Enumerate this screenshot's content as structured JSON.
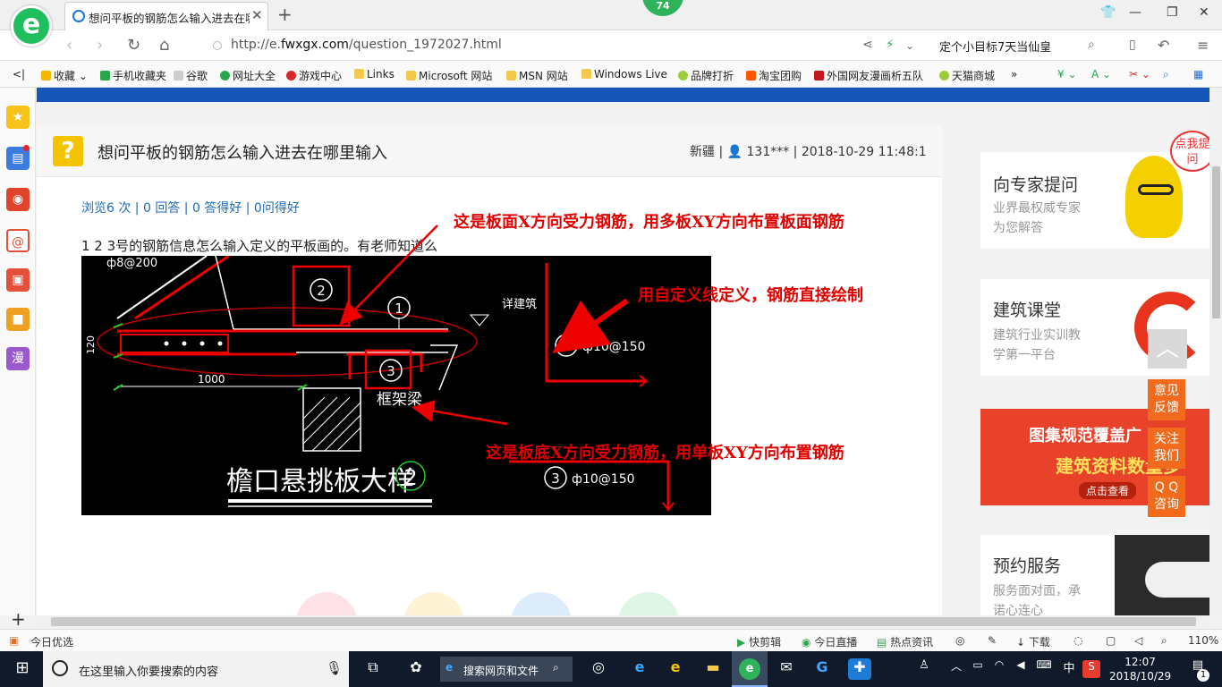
{
  "browser": {
    "logo": "e",
    "tab_title": "想问平板的钢筋怎么输入进去在哪里输入",
    "new_tab": "+",
    "badge": "74",
    "url_prefix": "http://e.",
    "url_domain": "fwxgx.com",
    "url_path": "/question_1972027.html",
    "search_text": "定个小目标7天当仙皇"
  },
  "bookmarks": [
    {
      "label": "收藏",
      "color": "#f5b800"
    },
    {
      "label": "手机收藏夹",
      "color": "#2aa74a"
    },
    {
      "label": "谷歌",
      "color": "#999999"
    },
    {
      "label": "网址大全",
      "color": "#2aa74a"
    },
    {
      "label": "游戏中心",
      "color": "#d42a2a"
    },
    {
      "label": "Links",
      "color": "#f2c94c"
    },
    {
      "label": "Microsoft 网站",
      "color": "#f2c94c"
    },
    {
      "label": "MSN 网站",
      "color": "#f2c94c"
    },
    {
      "label": "Windows Live",
      "color": "#f2c94c"
    },
    {
      "label": "品牌打折",
      "color": "#9bcc3a"
    },
    {
      "label": "淘宝团购",
      "color": "#ff5500"
    },
    {
      "label": "外国网友漫画析五队",
      "color": "#c4161c"
    },
    {
      "label": "天猫商城",
      "color": "#9bcc3a"
    }
  ],
  "sidebar_icons": [
    {
      "name": "favorites",
      "glyph": "★",
      "color": "#f7c21a"
    },
    {
      "name": "news",
      "glyph": "▤",
      "color": "#3c7be0"
    },
    {
      "name": "weibo",
      "glyph": "◉",
      "color": "#e0452c"
    },
    {
      "name": "mail",
      "glyph": "@",
      "color": "#e55039"
    },
    {
      "name": "games",
      "glyph": "▣",
      "color": "#e55039"
    },
    {
      "name": "reader",
      "glyph": "■",
      "color": "#f0a020"
    },
    {
      "name": "comic",
      "glyph": "漫",
      "color": "#9b59d0"
    }
  ],
  "question": {
    "mark": "?",
    "title": "想问平板的钢筋怎么输入进去在哪里输入",
    "meta": "新疆 | 👤 131*** | 2018-10-29 11:48:1",
    "stats": "浏览6 次 | 0 回答 | 0 答得好 | 0问得好",
    "body": "1 2 3号的钢筋信息怎么输入定义的平板画的。有老师知道么"
  },
  "annotations": {
    "top": "这是板面X方向受力钢筋，用多板XY方向布置板面钢筋",
    "right": "用自定义线定义，钢筋直接绘制",
    "bottom": "这是板底X方向受力钢筋，用单板XY方向布置钢筋"
  },
  "drawing": {
    "rebar_top": "ф8@200",
    "dim_120": "120",
    "dim_1000": "1000",
    "label_1": "1",
    "label_2": "2",
    "label_3": "3",
    "see_arch": "详建筑",
    "beam": "框架梁",
    "title": "檐口悬挑板大样",
    "title_num": "2",
    "spec_1": "ф10@150",
    "spec_3": "ф10@150"
  },
  "right_column": {
    "expert_title": "向专家提问",
    "expert_sub1": "业界最权威专家",
    "expert_sub2": "为您解答",
    "bubble": "点我提问",
    "course_title": "建筑课堂",
    "course_sub1": "建筑行业实训教",
    "course_sub2": "学第一平台",
    "banner_line1": "图集规范覆盖广",
    "banner_line2": "建筑资料数量多",
    "banner_btn": "点击查看",
    "service_title": "预约服务",
    "service_sub1": "服务面对面，承",
    "service_sub2": "诺心连心"
  },
  "float_buttons": [
    "意见\n反馈",
    "关注\n我们",
    "Q Q\n咨询"
  ],
  "status": {
    "left": "今日优选",
    "items": [
      "快剪辑",
      "今日直播",
      "热点资讯",
      "下载"
    ],
    "zoom": "110%"
  },
  "taskbar": {
    "search_placeholder": "在这里输入你要搜索的内容",
    "mini_search": "搜索网页和文件",
    "time": "12:07",
    "date": "2018/10/29",
    "lang": "中",
    "notif": "1"
  }
}
